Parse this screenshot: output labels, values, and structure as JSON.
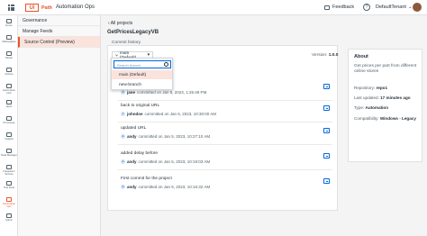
{
  "header": {
    "logo_mark": "Ui",
    "logo_text": "Path",
    "product": "Automation Ops",
    "feedback": "Feedback",
    "help": "?",
    "tenant": "DefaultTenant",
    "tenant_chevron": "⌄"
  },
  "leftnav": [
    {
      "label": "Home"
    },
    {
      "label": "Marketplace"
    },
    {
      "label": "Studio"
    },
    {
      "label": "Actions"
    },
    {
      "label": "Automation Hub"
    },
    {
      "label": "Apps"
    },
    {
      "label": "Processes"
    },
    {
      "label": "Insights"
    },
    {
      "label": "Data Manager"
    },
    {
      "label": "Integration Service"
    },
    {
      "label": "Test Suite"
    },
    {
      "label": "Automation Ops"
    },
    {
      "label": "Admin"
    }
  ],
  "subnav": {
    "items": [
      {
        "label": "Governance"
      },
      {
        "label": "Manage Feeds"
      },
      {
        "label": "Source Control (Preview)"
      }
    ]
  },
  "main": {
    "back": "All projects",
    "title": "GetPricesLegacyVB",
    "section": "Commit history",
    "branch": "main (Default)",
    "version_label": "Version:",
    "version_value": "1.0.0"
  },
  "dropdown": {
    "search_placeholder": "Search branch",
    "options": [
      "main (Default)",
      "new-branch"
    ]
  },
  "commits": [
    {
      "message": "",
      "author": "jane",
      "date": "committed on Jan 5, 2023, 1:26:49 PM"
    },
    {
      "message": "back to original URL",
      "author": "johndoe",
      "date": "committed on Jan 5, 2023, 10:30:00 AM"
    },
    {
      "message": "updated URL",
      "author": "andy",
      "date": "committed on Jan 5, 2023, 10:27:10 AM"
    },
    {
      "message": "added delay before",
      "author": "andy",
      "date": "committed on Jan 5, 2023, 10:19:03 AM"
    },
    {
      "message": "First commit for the project",
      "author": "andy",
      "date": "committed on Jan 5, 2023, 10:16:32 AM"
    }
  ],
  "about": {
    "title": "About",
    "description": "Get prices per part from different online stores",
    "repository_label": "Repository:",
    "repository": "repo1",
    "updated_label": "Last updated:",
    "updated": "17 minutes ago",
    "type_label": "Type:",
    "type": "Automation",
    "compat_label": "Compatibility:",
    "compat": "Windows - Legacy"
  }
}
